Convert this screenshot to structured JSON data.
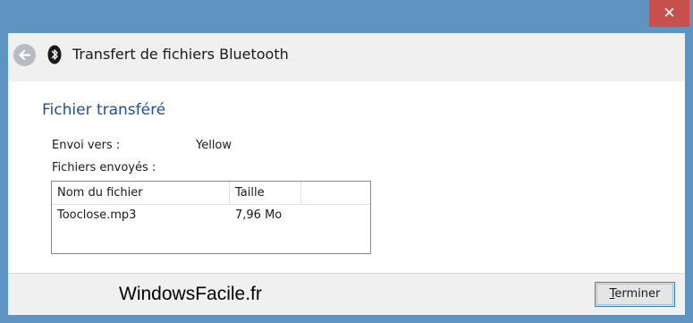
{
  "window": {
    "close_glyph": "✕",
    "title": "Transfert de fichiers Bluetooth"
  },
  "icons": {
    "back": "back-arrow-icon",
    "bluetooth": "bluetooth-icon",
    "close": "close-icon"
  },
  "content": {
    "section_title": "Fichier transféré",
    "send_to_label": "Envoi vers :",
    "send_to_value": "Yellow",
    "files_sent_label": "Fichiers envoyés :"
  },
  "table": {
    "columns": [
      "Nom du fichier",
      "Taille",
      ""
    ],
    "rows": [
      {
        "name": "Tooclose.mp3",
        "size": "7,96 Mo"
      }
    ]
  },
  "footer": {
    "watermark": "WindowsFacile.fr",
    "finish_first": "T",
    "finish_rest": "erminer"
  },
  "colors": {
    "frame": "#5f93c1",
    "close": "#c7504c",
    "heading": "#1e4fa3"
  }
}
